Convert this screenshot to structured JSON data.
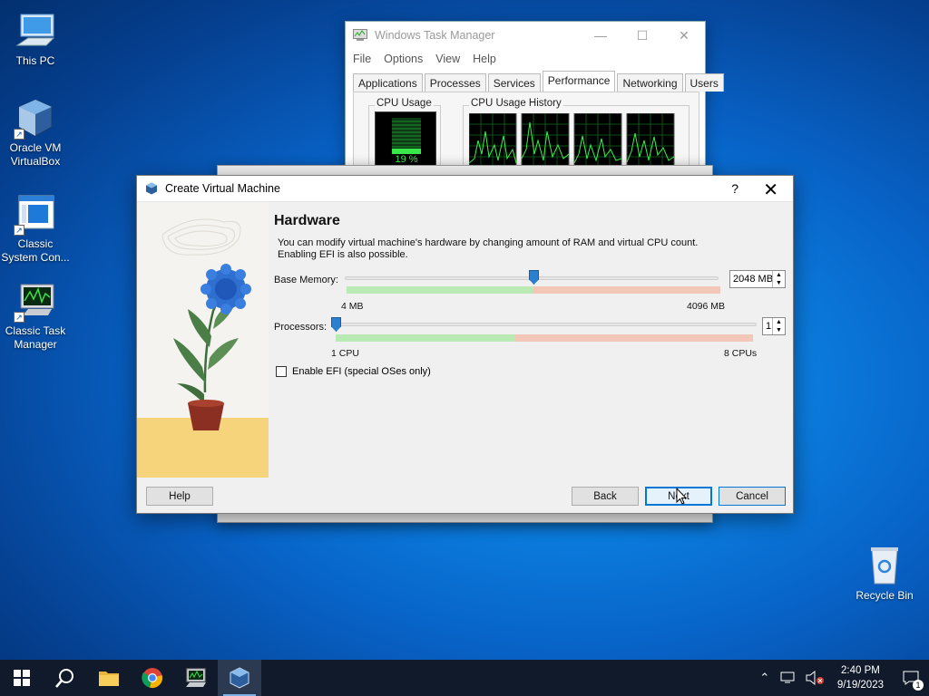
{
  "desktop": {
    "icons": [
      {
        "label": "This PC",
        "icon": "computer-icon"
      },
      {
        "label": "Oracle VM VirtualBox",
        "icon": "virtualbox-icon"
      },
      {
        "label": "Classic System Con...",
        "icon": "control-panel-icon"
      },
      {
        "label": "Classic Task Manager",
        "icon": "task-manager-icon"
      },
      {
        "label": "Recycle Bin",
        "icon": "recycle-bin-icon"
      }
    ]
  },
  "task_manager": {
    "title": "Windows Task Manager",
    "controls": {
      "minimize": "—",
      "maximize": "☐",
      "close": "✕"
    },
    "menu": [
      "File",
      "Options",
      "View",
      "Help"
    ],
    "tabs": [
      "Applications",
      "Processes",
      "Services",
      "Performance",
      "Networking",
      "Users"
    ],
    "active_tab": "Performance",
    "cpu_usage_label": "CPU Usage",
    "cpu_usage_value": "19 %",
    "cpu_history_label": "CPU Usage History"
  },
  "dialog": {
    "title": "Create Virtual Machine",
    "help_glyph": "?",
    "close_glyph": "✕",
    "heading": "Hardware",
    "description_line1": "You can modify virtual machine's hardware by changing amount of RAM and virtual CPU count.",
    "description_line2": "Enabling EFI is also possible.",
    "memory": {
      "label": "Base Memory:",
      "value": "2048 MB",
      "min_label": "4 MB",
      "max_label": "4096 MB",
      "position": 0.5,
      "green_fraction": 0.5
    },
    "processors": {
      "label": "Processors:",
      "value": "1",
      "min_label": "1 CPU",
      "max_label": "8 CPUs",
      "position": 0.0,
      "green_fraction": 0.43
    },
    "efi": {
      "label": "Enable EFI (special OSes only)",
      "checked": false
    },
    "buttons": {
      "help": "Help",
      "back": "Back",
      "next": "Next",
      "cancel": "Cancel"
    }
  },
  "taskbar": {
    "items": [
      "start-icon",
      "search-icon",
      "file-explorer-icon",
      "chrome-icon",
      "task-manager-icon",
      "virtualbox-icon"
    ],
    "active_item": "virtualbox-icon",
    "time": "2:40 PM",
    "date": "9/19/2023",
    "notification_count": "1"
  }
}
